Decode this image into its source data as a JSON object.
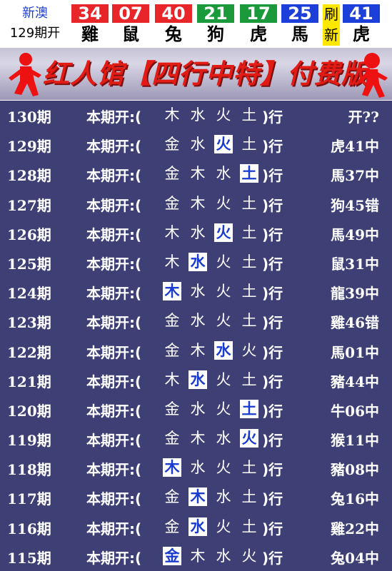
{
  "header": {
    "region": "新澳",
    "issue": "129期开",
    "refresh_label": [
      "刷",
      "新"
    ],
    "balls": [
      {
        "num": "34",
        "zodiac": "雞",
        "color": "#e8262a"
      },
      {
        "num": "07",
        "zodiac": "鼠",
        "color": "#e8262a"
      },
      {
        "num": "40",
        "zodiac": "兔",
        "color": "#e8262a"
      },
      {
        "num": "21",
        "zodiac": "狗",
        "color": "#1a9a3a"
      },
      {
        "num": "17",
        "zodiac": "虎",
        "color": "#1a9a3a"
      },
      {
        "num": "25",
        "zodiac": "馬",
        "color": "#1b3fd8"
      },
      {
        "num": "41",
        "zodiac": "虎",
        "color": "#1b3fd8"
      }
    ]
  },
  "banner": {
    "title": "红人馆【四行中特】付费版"
  },
  "list": {
    "label": "本期开:(",
    "close": ")行",
    "rows": [
      {
        "period": "130期",
        "elements": [
          "木",
          "水",
          "火",
          "土"
        ],
        "hl": -1,
        "result": "开??"
      },
      {
        "period": "129期",
        "elements": [
          "金",
          "水",
          "火",
          "土"
        ],
        "hl": 2,
        "result": "虎41中"
      },
      {
        "period": "128期",
        "elements": [
          "金",
          "木",
          "水",
          "土"
        ],
        "hl": 3,
        "result": "馬37中"
      },
      {
        "period": "127期",
        "elements": [
          "金",
          "木",
          "火",
          "土"
        ],
        "hl": -1,
        "result": "狗45错"
      },
      {
        "period": "126期",
        "elements": [
          "木",
          "水",
          "火",
          "土"
        ],
        "hl": 2,
        "result": "馬49中"
      },
      {
        "period": "125期",
        "elements": [
          "木",
          "水",
          "火",
          "土"
        ],
        "hl": 1,
        "result": "鼠31中"
      },
      {
        "period": "124期",
        "elements": [
          "木",
          "水",
          "火",
          "土"
        ],
        "hl": 0,
        "result": "龍39中"
      },
      {
        "period": "123期",
        "elements": [
          "金",
          "水",
          "火",
          "土"
        ],
        "hl": -1,
        "result": "雞46错"
      },
      {
        "period": "122期",
        "elements": [
          "金",
          "木",
          "水",
          "火"
        ],
        "hl": 2,
        "result": "馬01中"
      },
      {
        "period": "121期",
        "elements": [
          "木",
          "水",
          "火",
          "土"
        ],
        "hl": 1,
        "result": "豬44中"
      },
      {
        "period": "120期",
        "elements": [
          "金",
          "水",
          "火",
          "土"
        ],
        "hl": 3,
        "result": "牛06中"
      },
      {
        "period": "119期",
        "elements": [
          "金",
          "木",
          "水",
          "火"
        ],
        "hl": 3,
        "result": "猴11中"
      },
      {
        "period": "118期",
        "elements": [
          "木",
          "水",
          "火",
          "土"
        ],
        "hl": 0,
        "result": "豬08中"
      },
      {
        "period": "117期",
        "elements": [
          "金",
          "木",
          "水",
          "土"
        ],
        "hl": 1,
        "result": "兔16中"
      },
      {
        "period": "116期",
        "elements": [
          "金",
          "水",
          "火",
          "土"
        ],
        "hl": 1,
        "result": "雞22中"
      },
      {
        "period": "115期",
        "elements": [
          "金",
          "木",
          "水",
          "火"
        ],
        "hl": 0,
        "result": "兔04中"
      }
    ]
  }
}
